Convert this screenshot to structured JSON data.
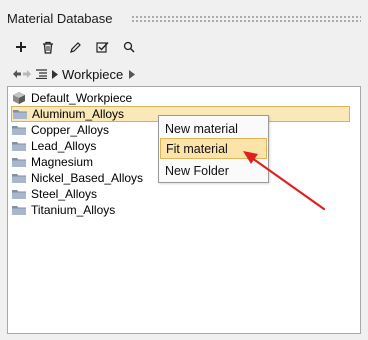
{
  "panel": {
    "title": "Material Database"
  },
  "toolbar": {
    "buttons": [
      {
        "icon": "plus-icon"
      },
      {
        "icon": "trash-icon"
      },
      {
        "icon": "pencil-icon"
      },
      {
        "icon": "checkbox-check-icon"
      },
      {
        "icon": "search-icon"
      }
    ]
  },
  "breadcrumb": {
    "current": "Workpiece"
  },
  "tree": {
    "items": [
      {
        "label": "Default_Workpiece",
        "icon": "cube-icon",
        "selected": false
      },
      {
        "label": "Aluminum_Alloys",
        "icon": "folder-icon",
        "selected": true
      },
      {
        "label": "Copper_Alloys",
        "icon": "folder-icon",
        "selected": false
      },
      {
        "label": "Lead_Alloys",
        "icon": "folder-icon",
        "selected": false
      },
      {
        "label": "Magnesium",
        "icon": "folder-icon",
        "selected": false
      },
      {
        "label": "Nickel_Based_Alloys",
        "icon": "folder-icon",
        "selected": false
      },
      {
        "label": "Steel_Alloys",
        "icon": "folder-icon",
        "selected": false
      },
      {
        "label": "Titanium_Alloys",
        "icon": "folder-icon",
        "selected": false
      }
    ]
  },
  "context_menu": {
    "items": [
      {
        "label": "New material",
        "highlighted": false
      },
      {
        "label": "Fit material",
        "highlighted": true
      },
      {
        "label": "New Folder",
        "highlighted": false
      }
    ]
  },
  "colors": {
    "selection_bg": "#fbe8b8",
    "menu_highlight": "#fbe3a9",
    "annotation_arrow": "#e02020"
  }
}
